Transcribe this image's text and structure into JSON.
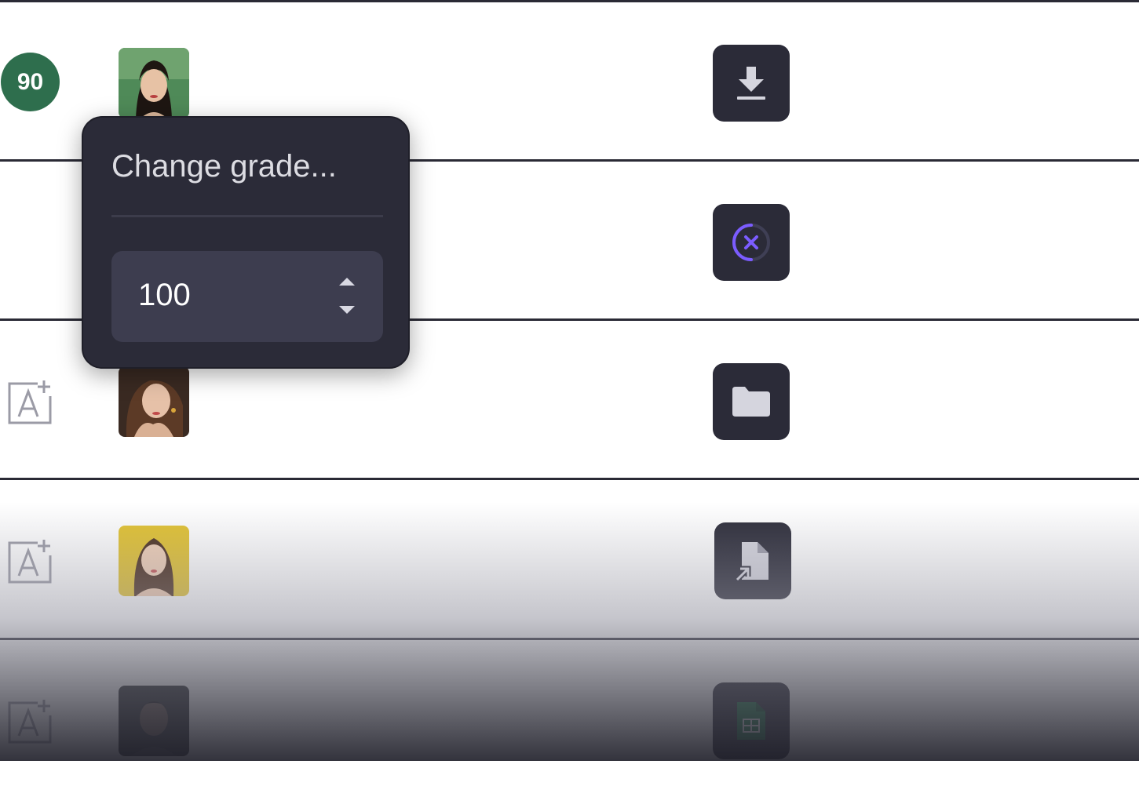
{
  "rows": [
    {
      "grade": "90",
      "avatar": "student-avatar-1",
      "student_name": "",
      "file_icon": "download-icon",
      "file_title": ""
    },
    {
      "grade": "",
      "avatar": "",
      "student_name": "",
      "file_icon": "cancel-loading-icon",
      "file_title": ""
    },
    {
      "grade_icon": "add-grade-icon",
      "avatar": "student-avatar-3",
      "student_name": "",
      "file_icon": "folder-icon",
      "file_title": ""
    },
    {
      "grade_icon": "add-grade-icon",
      "avatar": "student-avatar-4",
      "student_name": "",
      "file_icon": "shortcut-file-icon",
      "file_title": ""
    },
    {
      "grade_icon": "add-grade-icon",
      "avatar": "student-avatar-5",
      "student_name": "",
      "file_icon": "spreadsheet-icon",
      "file_title": ""
    }
  ],
  "popover": {
    "title": "Change grade...",
    "input_value": "100",
    "stepper_up_icon": "caret-up-icon",
    "stepper_down_icon": "caret-down-icon"
  },
  "colors": {
    "grade_badge": "#2e6e4d",
    "button_bg": "#2b2b38",
    "accent": "#7b5cff",
    "popover_bg": "#2b2b38",
    "input_bg": "#3d3d4f"
  }
}
